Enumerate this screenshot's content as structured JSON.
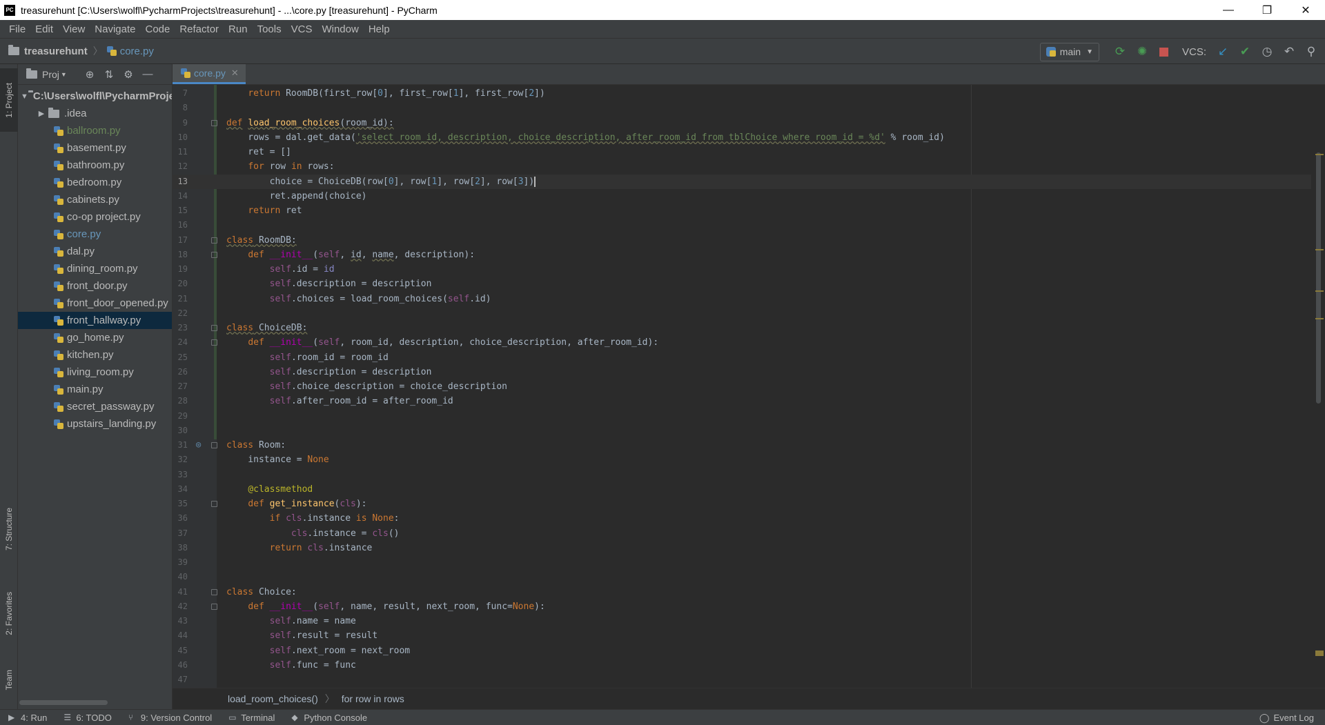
{
  "window": {
    "title": "treasurehunt [C:\\Users\\wolfl\\PycharmProjects\\treasurehunt] - ...\\core.py [treasurehunt] - PyCharm",
    "app_icon_text": "PC",
    "minimize": "—",
    "restore": "❐",
    "close": "✕"
  },
  "menu": {
    "items": [
      "File",
      "Edit",
      "View",
      "Navigate",
      "Code",
      "Refactor",
      "Run",
      "Tools",
      "VCS",
      "Window",
      "Help"
    ]
  },
  "navbar": {
    "project": "treasurehunt",
    "file": "core.py",
    "run_config": "main",
    "vcs_label": "VCS:",
    "icons": [
      "rerun-icon",
      "debug-icon",
      "stop-icon",
      "vcs-update-icon",
      "vcs-commit-icon",
      "history-icon",
      "revert-icon",
      "search-icon"
    ]
  },
  "left_tabs": {
    "project": "1: Project",
    "structure": "7: Structure",
    "favorites": "2: Favorites",
    "team": "Team"
  },
  "project_panel": {
    "title": "Proj",
    "root": "C:\\Users\\wolfl\\PycharmProjects\\treasurehunt",
    "idea": ".idea",
    "files": [
      "ballroom.py",
      "basement.py",
      "bathroom.py",
      "bedroom.py",
      "cabinets.py",
      "co-op project.py",
      "core.py",
      "dal.py",
      "dining_room.py",
      "front_door.py",
      "front_door_opened.py",
      "front_hallway.py",
      "go_home.py",
      "kitchen.py",
      "living_room.py",
      "main.py",
      "secret_passway.py",
      "upstairs_landing.py"
    ],
    "selected_file": "front_hallway.py",
    "colors": {
      "modified": "#6a8759",
      "active": "#6897bb",
      "default": "#bbbbbb"
    }
  },
  "editor": {
    "tab": "core.py",
    "close": "✕",
    "current_line": 13,
    "line_numbers": [
      "7",
      "8",
      "9",
      "10",
      "11",
      "12",
      "13",
      "14",
      "15",
      "16",
      "17",
      "18",
      "19",
      "20",
      "21",
      "22",
      "23",
      "24",
      "25",
      "26",
      "27",
      "28",
      "29",
      "30",
      "31",
      "32",
      "33",
      "34",
      "35",
      "36",
      "37",
      "38",
      "39",
      "40",
      "41",
      "42",
      "43",
      "44",
      "45",
      "46",
      "47"
    ]
  },
  "breadcrumb": {
    "items": [
      "load_room_choices()",
      "for row in rows"
    ]
  },
  "bottom_tabs": {
    "run": "4: Run",
    "todo": "6: TODO",
    "vcs": "9: Version Control",
    "terminal": "Terminal",
    "console": "Python Console",
    "event_log": "Event Log"
  },
  "colors": {
    "background": "#2b2b2b",
    "panel": "#3c3f41",
    "selection": "#0d293e",
    "keyword": "#cc7832",
    "function": "#ffc66d",
    "string": "#6a8759",
    "number": "#6897bb",
    "self": "#94558d"
  }
}
